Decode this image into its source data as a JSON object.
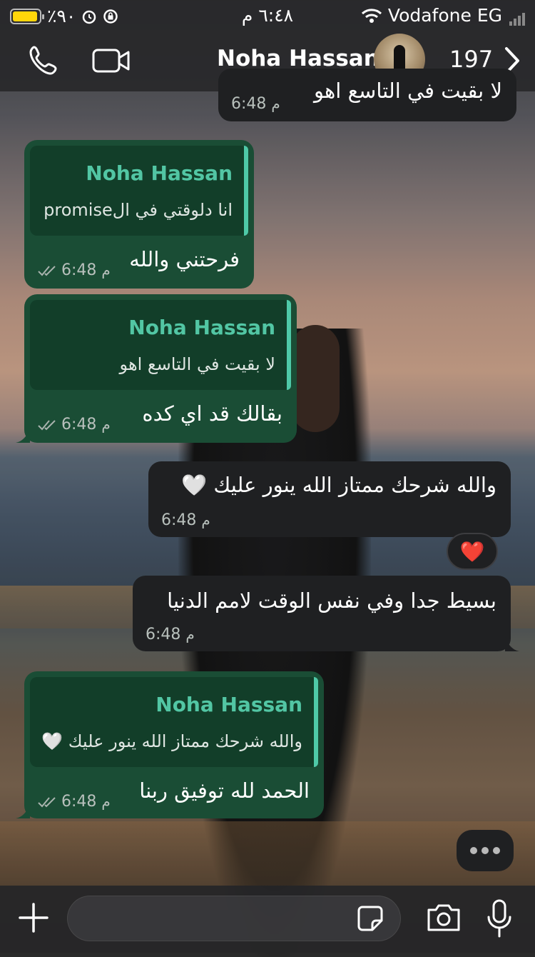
{
  "status_bar": {
    "battery_percent": "٪٩٠",
    "time": "٦:٤٨ م",
    "carrier": "Vodafone EG"
  },
  "header": {
    "contact_name": "Noha Hassan",
    "unread_count": "197",
    "icons": [
      "phone-icon",
      "video-camera-icon",
      "avatar",
      "chevron-right-icon"
    ]
  },
  "messages": [
    {
      "direction": "incoming",
      "text": "لا بقيت في التاسع اهو",
      "time": "6:48",
      "ampm": "م"
    },
    {
      "direction": "outgoing",
      "quote_name": "Noha Hassan",
      "quote_text": "انا دلوقتي في الpromise",
      "text": "فرحتني والله",
      "time": "6:48",
      "ampm": "م"
    },
    {
      "direction": "outgoing",
      "quote_name": "Noha Hassan",
      "quote_text": "لا بقيت في التاسع اهو",
      "text": "بقالك قد اي كده",
      "time": "6:48",
      "ampm": "م"
    },
    {
      "direction": "incoming",
      "text": "والله شرحك ممتاز الله ينور عليك 🤍",
      "time": "6:48",
      "ampm": "م",
      "reaction": "❤️"
    },
    {
      "direction": "incoming",
      "text": "بسيط جدا وفي نفس الوقت لامم الدنيا",
      "time": "6:48",
      "ampm": "م"
    },
    {
      "direction": "outgoing",
      "quote_name": "Noha Hassan",
      "quote_text": "والله شرحك ممتاز الله ينور عليك 🤍",
      "text": "الحمد لله توفيق ربنا",
      "time": "6:48",
      "ampm": "م"
    }
  ],
  "composer": {
    "placeholder": "",
    "icons": [
      "plus-icon",
      "sticker-icon",
      "camera-icon",
      "microphone-icon"
    ]
  },
  "colors": {
    "outgoing_bubble": "#1a4d35",
    "incoming_bubble": "#1f2022",
    "quote_accent": "#4fc9a8"
  }
}
